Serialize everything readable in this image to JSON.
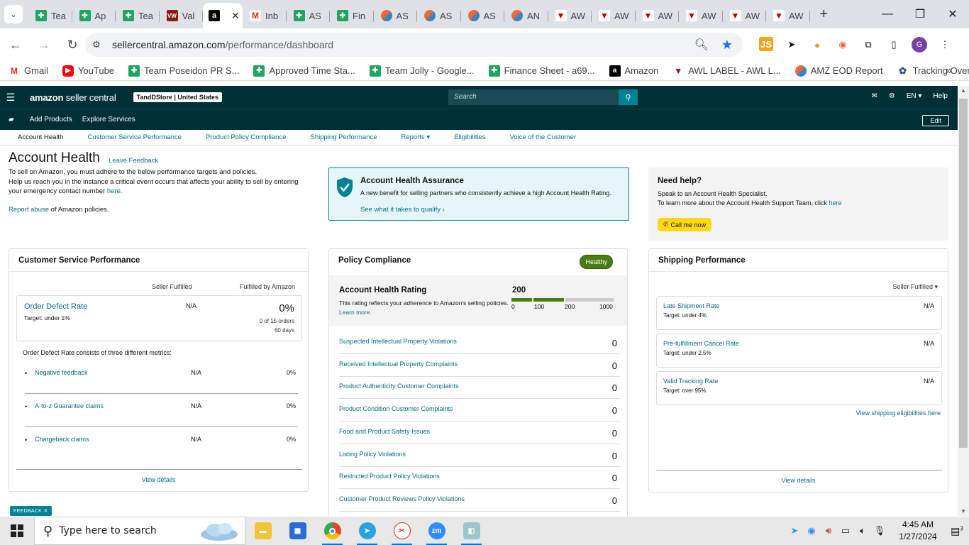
{
  "browser": {
    "tabs": [
      {
        "label": "Tea",
        "icon": "sheet"
      },
      {
        "label": "Ap",
        "icon": "sheet"
      },
      {
        "label": "Tea",
        "icon": "sheet"
      },
      {
        "label": "Val",
        "icon": "vw"
      },
      {
        "label": "",
        "icon": "amz",
        "active": true
      },
      {
        "label": "Inb",
        "icon": "gm"
      },
      {
        "label": "AS",
        "icon": "sheet"
      },
      {
        "label": "Fin",
        "icon": "sheet"
      },
      {
        "label": "AS",
        "icon": "asn"
      },
      {
        "label": "AS",
        "icon": "asn"
      },
      {
        "label": "AS",
        "icon": "asn"
      },
      {
        "label": "AN",
        "icon": "asn"
      },
      {
        "label": "AW",
        "icon": "awl"
      },
      {
        "label": "AW",
        "icon": "awl"
      },
      {
        "label": "AW",
        "icon": "awl"
      },
      {
        "label": "AW",
        "icon": "awl"
      },
      {
        "label": "AW",
        "icon": "awl"
      },
      {
        "label": "AW",
        "icon": "awl"
      }
    ],
    "url_domain": "sellercentral.amazon.com",
    "url_path": "/performance/dashboard",
    "profile_initial": "G",
    "ext_js": "JS",
    "bookmarks": [
      {
        "label": "Gmail",
        "icon": "gm"
      },
      {
        "label": "YouTube",
        "icon": "yt"
      },
      {
        "label": "Team Poseidon PR S...",
        "icon": "sheet"
      },
      {
        "label": "Approved Time Sta...",
        "icon": "sheet"
      },
      {
        "label": "Team Jolly - Google...",
        "icon": "sheet"
      },
      {
        "label": "Finance Sheet - a69...",
        "icon": "sheet"
      },
      {
        "label": "Amazon",
        "icon": "amz"
      },
      {
        "label": "AWL LABEL - AWL L...",
        "icon": "awl"
      },
      {
        "label": "AMZ EOD Report",
        "icon": "asn"
      },
      {
        "label": "Tracking Overview",
        "icon": "track"
      }
    ]
  },
  "header": {
    "logo_bold": "amazon",
    "logo_rest": " seller central",
    "store": "TandDStore | United States",
    "search_placeholder": "Search",
    "lang": "EN",
    "help": "Help",
    "sub_items": [
      "Add Products",
      "Explore Services"
    ],
    "edit": "Edit",
    "nav": [
      "Account Health",
      "Customer Service Performance",
      "Product Policy Compliance",
      "Shipping Performance",
      "Reports",
      "Eligibilities",
      "Voice of the Customer"
    ]
  },
  "page": {
    "title": "Account Health",
    "leave_feedback": "Leave Feedback",
    "intro1": "To sell on Amazon, you must adhere to the below performance targets and policies.",
    "intro2": "Help us reach you in the instance a critical event occurs that affects your ability to sell by entering your emergency contact number",
    "intro2_link": "here.",
    "report_link": "Report abuse",
    "report_rest": " of Amazon policies.",
    "feedback_tab": "FEEDBACK"
  },
  "aha": {
    "title": "Account Health Assurance",
    "desc": "A new benefit for selling partners who consistently achieve a high Account Health Rating.",
    "link": "See what it takes to qualify"
  },
  "help": {
    "title": "Need help?",
    "line1": "Speak to an Account Health Specialist.",
    "line2": "To learn more about the Account Health Support Team, click",
    "line2_link": "here",
    "call": "Call me now"
  },
  "csp": {
    "title": "Customer Service Performance",
    "col1": "Seller Fulfilled",
    "col2": "Fulfilled by Amazon",
    "odr_name": "Order Defect Rate",
    "odr_target": "Target: under 1%",
    "odr_sf": "N/A",
    "odr_pct": "0%",
    "odr_orders": "0 of 15 orders",
    "odr_days": "60 days",
    "consists": "Order Defect Rate consists of three different metrics:",
    "metrics": [
      {
        "name": "Negative feedback",
        "sf": "N/A",
        "fba": "0%"
      },
      {
        "name": "A-to-z Guarantee claims",
        "sf": "N/A",
        "fba": "0%"
      },
      {
        "name": "Chargeback claims",
        "sf": "N/A",
        "fba": "0%"
      }
    ],
    "view": "View details"
  },
  "policy": {
    "title": "Policy Compliance",
    "badge": "Healthy",
    "ahr_title": "Account Health Rating",
    "ahr_desc": "This rating reflects your adherence to Amazon's selling policies.",
    "ahr_link": "Learn more.",
    "score": "200",
    "scale": [
      "0",
      "100",
      "200",
      "1000"
    ],
    "rows": [
      {
        "name": "Suspected Intellectual Property Violations",
        "value": "0"
      },
      {
        "name": "Received Intellectual Property Complaints",
        "value": "0"
      },
      {
        "name": "Product Authenticity Customer Complaints",
        "value": "0"
      },
      {
        "name": "Product Condition Customer Complaints",
        "value": "0"
      },
      {
        "name": "Food and Product Safety Issues",
        "value": "0"
      },
      {
        "name": "Listing Policy Violations",
        "value": "0"
      },
      {
        "name": "Restricted Product Policy Violations",
        "value": "0"
      },
      {
        "name": "Customer Product Reviews Policy Violations",
        "value": "0"
      }
    ]
  },
  "shipping": {
    "title": "Shipping Performance",
    "filter": "Seller Fulfilled",
    "rows": [
      {
        "name": "Late Shipment Rate",
        "target": "Target: under 4%",
        "value": "N/A"
      },
      {
        "name": "Pre-fulfillment Cancel Rate",
        "target": "Target: under 2.5%",
        "value": "N/A"
      },
      {
        "name": "Valid Tracking Rate",
        "target": "Target: over 95%",
        "value": "N/A"
      }
    ],
    "eligibility": "View shipping eligibilities here",
    "view": "View details"
  },
  "taskbar": {
    "search_placeholder": "Type here to search",
    "time": "4:45 AM",
    "date": "1/27/2024",
    "notif_count": "3"
  },
  "colors": {
    "header": "#002f36",
    "link": "#007185",
    "healthy": "#4a7c12",
    "call": "#ffd814"
  }
}
